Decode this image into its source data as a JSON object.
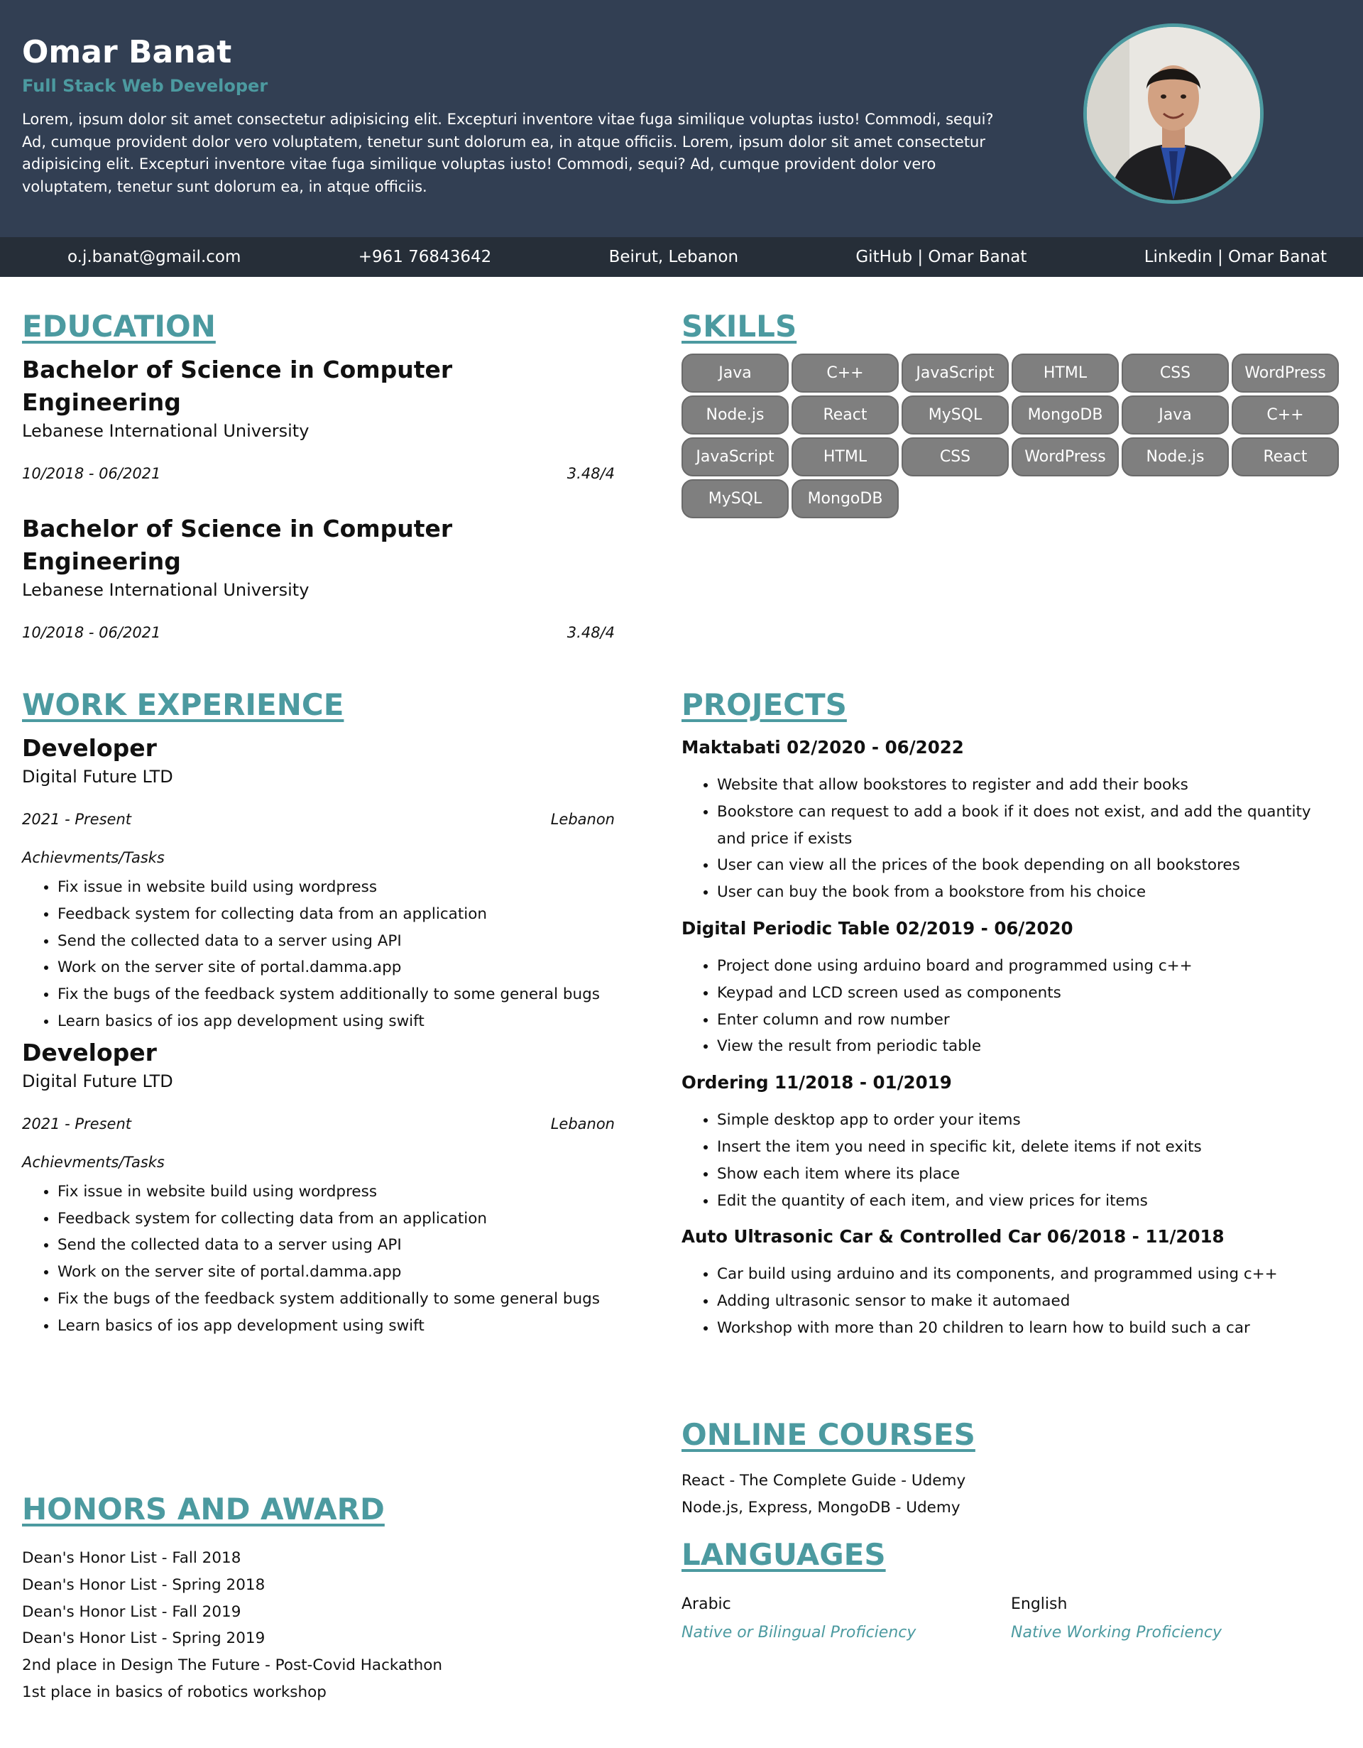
{
  "header": {
    "name": "Omar Banat",
    "role": "Full Stack Web Developer",
    "summary": "Lorem, ipsum dolor sit amet consectetur adipisicing elit. Excepturi inventore vitae fuga similique voluptas iusto! Commodi, sequi? Ad, cumque provident dolor vero voluptatem, tenetur sunt dolorum ea, in atque officiis. Lorem, ipsum dolor sit amet consectetur adipisicing elit. Excepturi inventore vitae fuga similique voluptas iusto! Commodi, sequi? Ad, cumque provident dolor vero voluptatem, tenetur sunt dolorum ea, in atque officiis."
  },
  "contact": {
    "email": "o.j.banat@gmail.com",
    "phone": "+961 76843642",
    "location": "Beirut, Lebanon",
    "github": "GitHub | Omar Banat",
    "linkedin": "Linkedin | Omar Banat"
  },
  "education": {
    "title": "EDUCATION",
    "items": [
      {
        "degree": "Bachelor of Science in Computer Engineering",
        "school": "Lebanese International University",
        "dates": "10/2018 - 06/2021",
        "gpa": "3.48/4"
      },
      {
        "degree": "Bachelor of Science in Computer Engineering",
        "school": "Lebanese International University",
        "dates": "10/2018 - 06/2021",
        "gpa": "3.48/4"
      }
    ]
  },
  "skills": {
    "title": "SKILLS",
    "items": [
      "Java",
      "C++",
      "JavaScript",
      "HTML",
      "CSS",
      "WordPress",
      "Node.js",
      "React",
      "MySQL",
      "MongoDB",
      "Java",
      "C++",
      "JavaScript",
      "HTML",
      "CSS",
      "WordPress",
      "Node.js",
      "React",
      "MySQL",
      "MongoDB"
    ]
  },
  "work": {
    "title": "WORK EXPERIENCE",
    "items": [
      {
        "position": "Developer",
        "company": "Digital Future LTD",
        "dates": "2021 - Present",
        "location": "Lebanon",
        "tasks_label": "Achievments/Tasks",
        "tasks": [
          "Fix issue in website build using wordpress",
          "Feedback system for collecting data from an application",
          "Send the collected data to a server using API",
          "Work on the server site of portal.damma.app",
          "Fix the bugs of the feedback system additionally to some general bugs",
          "Learn basics of ios app development using swift"
        ]
      },
      {
        "position": "Developer",
        "company": "Digital Future LTD",
        "dates": "2021 - Present",
        "location": "Lebanon",
        "tasks_label": "Achievments/Tasks",
        "tasks": [
          "Fix issue in website build using wordpress",
          "Feedback system for collecting data from an application",
          "Send the collected data to a server using API",
          "Work on the server site of portal.damma.app",
          "Fix the bugs of the feedback system additionally to some general bugs",
          "Learn basics of ios app development using swift"
        ]
      }
    ]
  },
  "projects": {
    "title": "PROJECTS",
    "items": [
      {
        "name": "Maktabati 02/2020 - 06/2022",
        "points": [
          "Website that allow bookstores to register and add their books",
          "Bookstore can request to add a book if it does not exist, and add the quantity and price if exists",
          "User can view all the prices of the book depending on all bookstores",
          "User can buy the book from a bookstore from his choice"
        ]
      },
      {
        "name": "Digital Periodic Table 02/2019 - 06/2020",
        "points": [
          "Project done using arduino board and programmed using c++",
          "Keypad and LCD screen used as components",
          "Enter column and row number",
          "View the result from periodic table"
        ]
      },
      {
        "name": "Ordering 11/2018 - 01/2019",
        "points": [
          "Simple desktop app to order your items",
          "Insert the item you need in specific kit, delete items if not exits",
          "Show each item where its place",
          "Edit the quantity of each item, and view prices for items"
        ]
      },
      {
        "name": "Auto Ultrasonic Car & Controlled Car 06/2018 - 11/2018",
        "points": [
          "Car build using arduino and its components, and programmed using c++",
          "Adding ultrasonic sensor to make it automaed",
          "Workshop with more than 20 children to learn how to build such a car"
        ]
      }
    ]
  },
  "courses": {
    "title": "ONLINE COURSES",
    "items": [
      "React - The Complete Guide - Udemy",
      "Node.js, Express, MongoDB - Udemy"
    ]
  },
  "languages": {
    "title": "LANGUAGES",
    "items": [
      {
        "name": "Arabic",
        "level": "Native or Bilingual Proficiency"
      },
      {
        "name": "English",
        "level": "Native Working Proficiency"
      }
    ]
  },
  "honors": {
    "title": "HONORS AND AWARD",
    "items": [
      "Dean's Honor List - Fall 2018",
      "Dean's Honor List - Spring 2018",
      "Dean's Honor List - Fall 2019",
      "Dean's Honor List - Spring 2019",
      "2nd place in Design The Future - Post-Covid Hackathon",
      "1st place in basics of robotics workshop"
    ]
  },
  "colors": {
    "accent": "#4c9aa0",
    "header_bg": "#323f53",
    "contact_bg": "#262e38",
    "skill_bg": "#7f7f7f"
  }
}
